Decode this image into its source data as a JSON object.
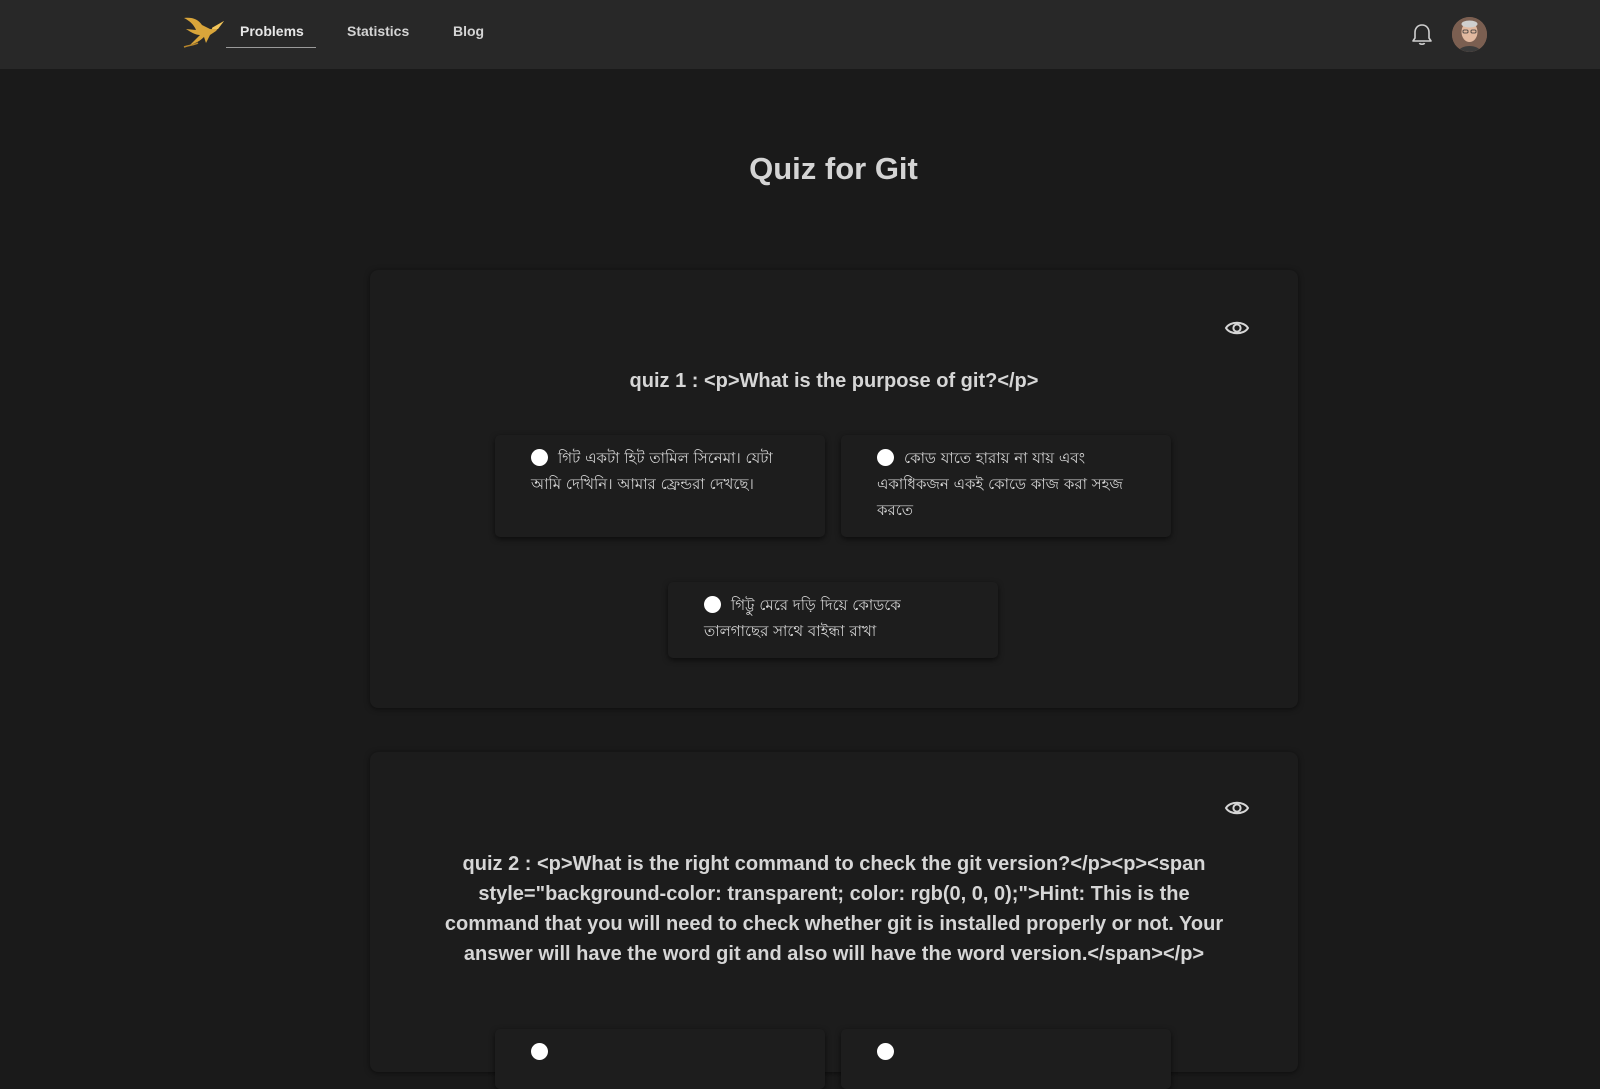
{
  "nav": {
    "links": [
      "Problems",
      "Statistics",
      "Blog"
    ],
    "active": "Problems"
  },
  "icons": {
    "logo": "hummingbird-logo",
    "notification": "bell-icon",
    "reveal": "eye-icon"
  },
  "colors": {
    "background": "#1a1a1a",
    "topbar": "#282828",
    "logo_gold": "#d9a53a"
  },
  "page": {
    "title": "Quiz for Git"
  },
  "quizzes": [
    {
      "question": "quiz 1 : <p>What is the purpose of git?</p>",
      "options": [
        "গিট একটা হিট তামিল সিনেমা। যেটা আমি দেখিনি। আমার ফ্রেন্ডরা দেখছে।",
        "কোড যাতে হারায় না যায় এবং একাধিকজন একই কোডে কাজ করা সহজ করতে",
        "গিট্টু মেরে দড়ি দিয়ে কোডকে তালগাছের সাথে বাইন্ধা রাখা"
      ]
    },
    {
      "question": "quiz 2 : <p>What is the right command to check the git version?</p><p><span style=\"background-color: transparent; color: rgb(0, 0, 0);\">Hint: This is the command that you will need to check whether git is installed properly or not. Your answer will have the word git and also will have the word version.</span></p>"
    }
  ]
}
